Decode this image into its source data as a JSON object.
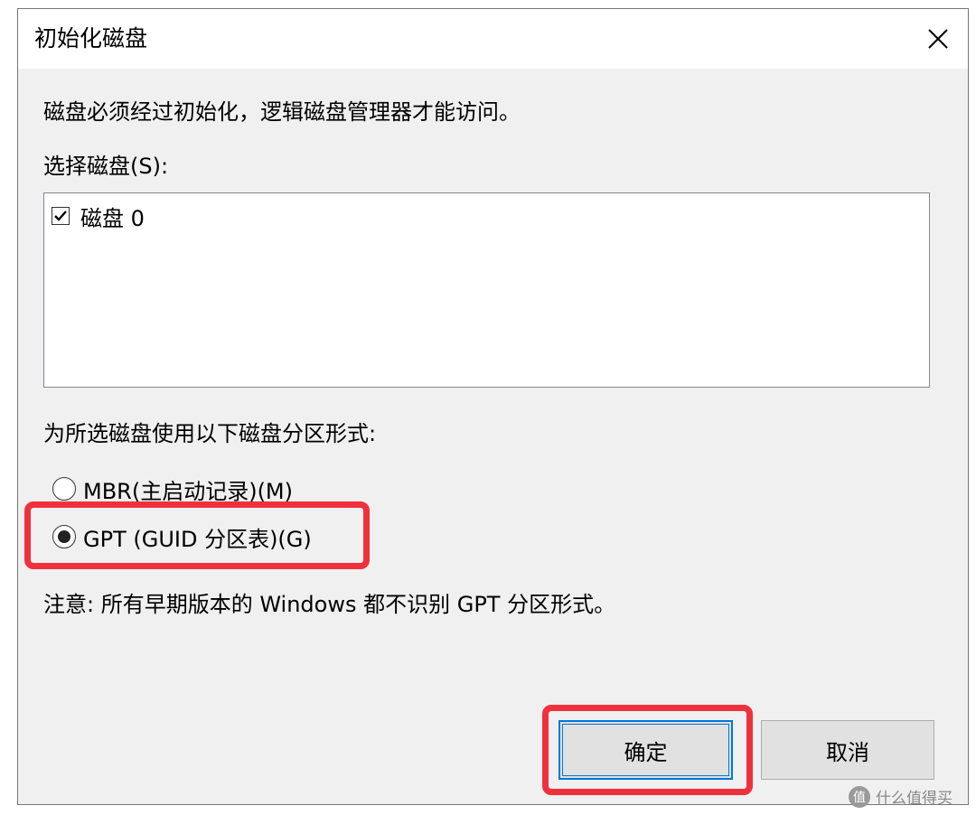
{
  "window": {
    "title": "初始化磁盘"
  },
  "body": {
    "description": "磁盘必须经过初始化，逻辑磁盘管理器才能访问。",
    "select_disk_label": "选择磁盘(S):",
    "disks": [
      {
        "label": "磁盘 0",
        "checked": true
      }
    ],
    "partition_style_label": "为所选磁盘使用以下磁盘分区形式:",
    "options": [
      {
        "label": "MBR(主启动记录)(M)",
        "selected": false
      },
      {
        "label": "GPT (GUID 分区表)(G)",
        "selected": true
      }
    ],
    "note": "注意: 所有早期版本的 Windows 都不识别 GPT 分区形式。"
  },
  "buttons": {
    "ok_label": "确定",
    "cancel_label": "取消"
  },
  "watermark": {
    "icon_text": "值",
    "text": "什么值得买"
  },
  "colors": {
    "highlight": "#f0313c",
    "focus_accent": "#0078d7",
    "dialog_bg": "#f0f0f0"
  },
  "icons": {
    "close": "close-icon",
    "check": "checkmark-icon"
  }
}
